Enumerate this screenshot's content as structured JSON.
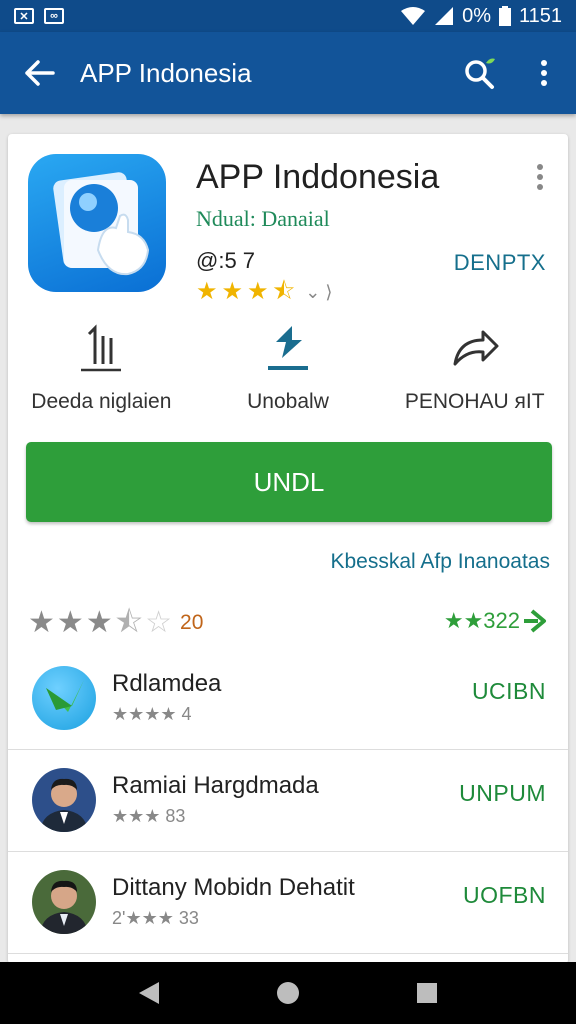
{
  "status_bar": {
    "time": "1151",
    "battery": "0%"
  },
  "app_bar": {
    "title": "APP Indonesia"
  },
  "app": {
    "name": "APP Inddonesia",
    "developer": "Ndual: Danaial",
    "rating_text": "@:5 7",
    "developer_tag": "DENPTX",
    "stars_filled": 3.5,
    "star_suffix": "⌄ ⟩"
  },
  "actions": [
    {
      "label": "Deeda niglaien",
      "icon": "rank-icon"
    },
    {
      "label": "Unobalw",
      "icon": "download-arrow-icon"
    },
    {
      "label": "PENOHAU ᴙIT",
      "icon": "share-arrow-icon"
    }
  ],
  "install_button": {
    "label": "UNDL"
  },
  "similar_link": "Kbesskal Afp Inanoatas",
  "rating_summary": {
    "stars": 3.5,
    "count": "20"
  },
  "green_rating": {
    "text": "★★322"
  },
  "list": [
    {
      "name": "Rdlamdea",
      "stars_text": "★★★★ 4",
      "action": "UCIBN",
      "avatar": "app-logo-avatar"
    },
    {
      "name": "Ramiai Hargdmada",
      "stars_text": "★★★ 83",
      "action": "UNPUM",
      "avatar": "person-avatar"
    },
    {
      "name": "Dittany Mobidn Dehatit",
      "stars_text": "2'★★★ 33",
      "action": "UOFBN",
      "avatar": "person-avatar"
    }
  ],
  "colors": {
    "app_bar": "#125499",
    "install": "#2e9e3a",
    "developer": "#1f8a5a"
  }
}
